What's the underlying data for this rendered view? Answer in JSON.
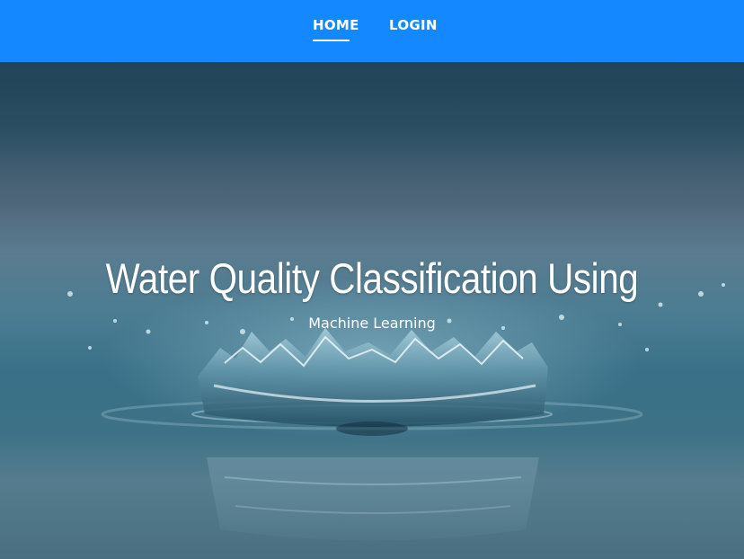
{
  "nav": {
    "home_label": "HOME",
    "login_label": "LOGIN"
  },
  "hero": {
    "title": "Water Quality Classification Using",
    "subtitle": "Machine Learning"
  },
  "colors": {
    "navbar": "#1489ff",
    "text": "#ffffff",
    "water_dark": "#25495e",
    "water_mid": "#4c7d93"
  }
}
